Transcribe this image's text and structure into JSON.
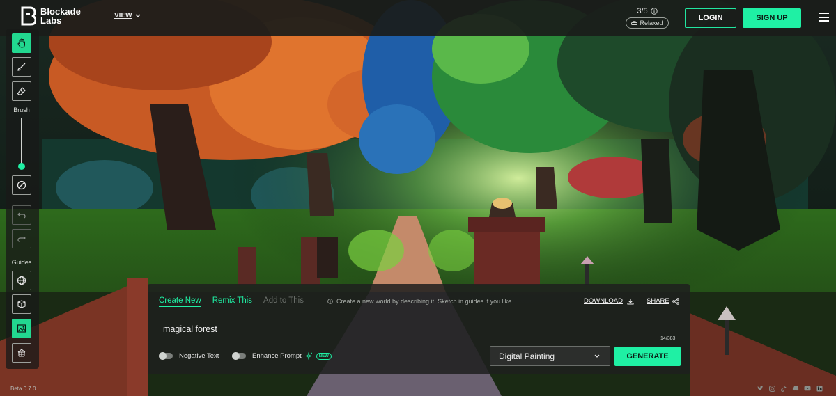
{
  "brand": {
    "line1": "Blockade",
    "line2": "Labs"
  },
  "header": {
    "view_label": "VIEW",
    "credits": "3/5",
    "mode": "Relaxed",
    "login_label": "LOGIN",
    "signup_label": "SIGN UP"
  },
  "toolbar": {
    "tools": [
      {
        "icon": "hand-icon",
        "active": true
      },
      {
        "icon": "brush-icon",
        "active": false
      },
      {
        "icon": "eraser-icon",
        "active": false
      }
    ],
    "brush_label": "Brush",
    "brush_size_fraction": 0.9,
    "guides_label": "Guides",
    "guides": [
      {
        "icon": "globe-icon",
        "active": false
      },
      {
        "icon": "cube-icon",
        "active": false
      },
      {
        "icon": "image-icon",
        "active": true
      },
      {
        "icon": "mesh-icon",
        "active": false
      }
    ],
    "version": "Beta 0.7.0"
  },
  "panel": {
    "tabs": [
      {
        "label": "Create New",
        "state": "active"
      },
      {
        "label": "Remix This",
        "state": "normal"
      },
      {
        "label": "Add to This",
        "state": "disabled"
      }
    ],
    "hint": "Create a new world by describing it. Sketch in guides if you like.",
    "download_label": "DOWNLOAD",
    "share_label": "SHARE",
    "prompt_value": "magical forest",
    "char_count": "14/383",
    "negative_text_label": "Negative Text",
    "enhance_prompt_label": "Enhance Prompt",
    "new_badge": "NEW",
    "style_value": "Digital Painting",
    "generate_label": "GENERATE"
  },
  "social": [
    "twitter-icon",
    "instagram-icon",
    "tiktok-icon",
    "discord-icon",
    "youtube-icon",
    "linkedin-icon"
  ],
  "colors": {
    "accent": "#1ff0a4",
    "panel": "#1e201e"
  }
}
